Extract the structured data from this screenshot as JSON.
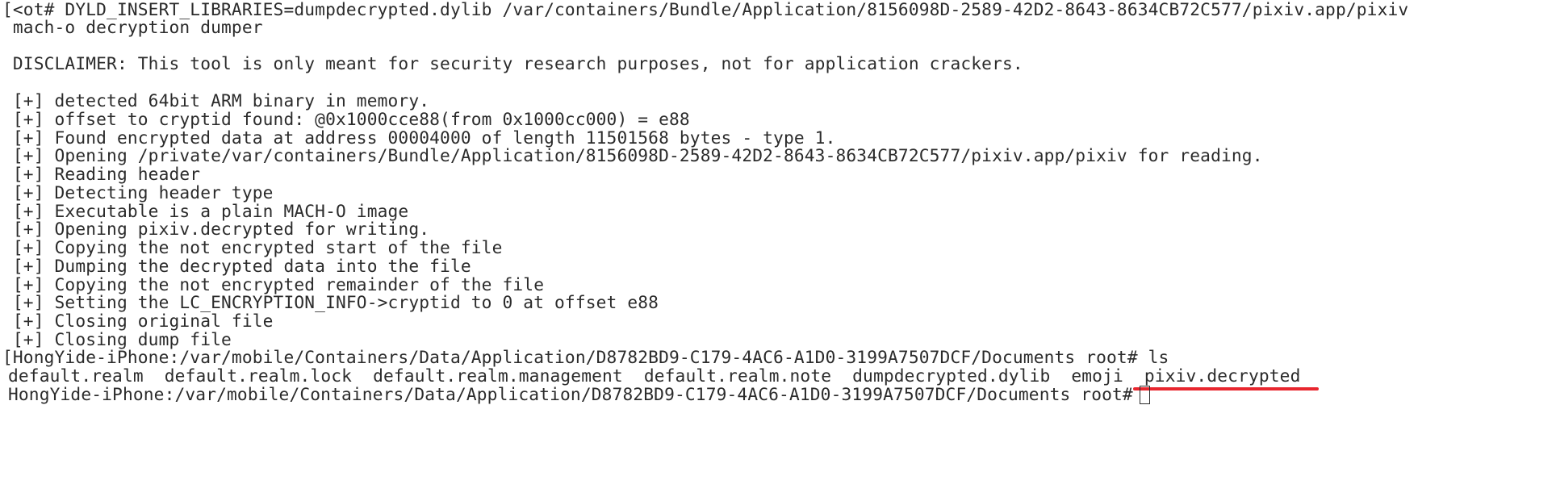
{
  "terminal": {
    "lines": [
      "[<ot# DYLD_INSERT_LIBRARIES=dumpdecrypted.dylib /var/containers/Bundle/Application/8156098D-2589-42D2-8643-8634CB72C577/pixiv.app/pixiv",
      " mach-o decryption dumper",
      "",
      " DISCLAIMER: This tool is only meant for security research purposes, not for application crackers.",
      "",
      " [+] detected 64bit ARM binary in memory.",
      " [+] offset to cryptid found: @0x1000cce88(from 0x1000cc000) = e88",
      " [+] Found encrypted data at address 00004000 of length 11501568 bytes - type 1.",
      " [+] Opening /private/var/containers/Bundle/Application/8156098D-2589-42D2-8643-8634CB72C577/pixiv.app/pixiv for reading.",
      " [+] Reading header",
      " [+] Detecting header type",
      " [+] Executable is a plain MACH-O image",
      " [+] Opening pixiv.decrypted for writing.",
      " [+] Copying the not encrypted start of the file",
      " [+] Dumping the decrypted data into the file",
      " [+] Copying the not encrypted remainder of the file",
      " [+] Setting the LC_ENCRYPTION_INFO->cryptid to 0 at offset e88",
      " [+] Closing original file",
      " [+] Closing dump file",
      "[HongYide-iPhone:/var/mobile/Containers/Data/Application/D8782BD9-C179-4AC6-A1D0-3199A7507DCF/Documents root# ls"
    ],
    "ls_output": {
      "files": [
        "default.realm",
        "default.realm.lock",
        "default.realm.management",
        "default.realm.note",
        "dumpdecrypted.dylib",
        "emoji"
      ],
      "highlighted_file": "pixiv.decrypted"
    },
    "prompt": "HongYide-iPhone:/var/mobile/Containers/Data/Application/D8782BD9-C179-4AC6-A1D0-3199A7507DCF/Documents root#",
    "colors": {
      "text": "#2b2b2b",
      "background": "#ffffff",
      "highlight_underline": "#e8262e"
    }
  }
}
